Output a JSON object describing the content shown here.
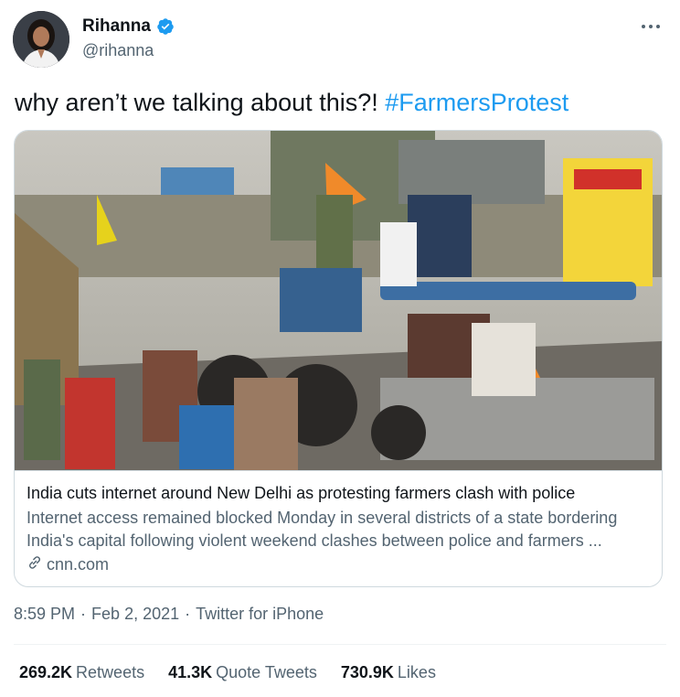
{
  "author": {
    "name": "Rihanna",
    "handle": "@rihanna",
    "verified": true
  },
  "tweet": {
    "text": "why aren’t we talking about this?!",
    "hashtag": "#FarmersProtest"
  },
  "card": {
    "image_description_icon": "photo",
    "title": "India cuts internet around New Delhi as protesting farmers clash with police",
    "description_line1": "Internet access remained blocked Monday in several districts of a state bordering",
    "description_line2": "India's capital following violent weekend clashes between police and farmers ...",
    "domain": "cnn.com",
    "domain_icon": "link-icon"
  },
  "meta": {
    "time": "8:59 PM",
    "dot1": "·",
    "date": "Feb 2, 2021",
    "dot2": "·",
    "source": "Twitter for iPhone"
  },
  "stats": {
    "retweets": "269.2K",
    "retweets_label": "Retweets",
    "quote_tweets": "41.3K",
    "quote_tweets_label": "Quote Tweets",
    "likes": "730.9K",
    "likes_label": "Likes"
  },
  "colors": {
    "link": "#1d9bf0",
    "secondary_text": "#536471",
    "border": "#cfd9de"
  }
}
